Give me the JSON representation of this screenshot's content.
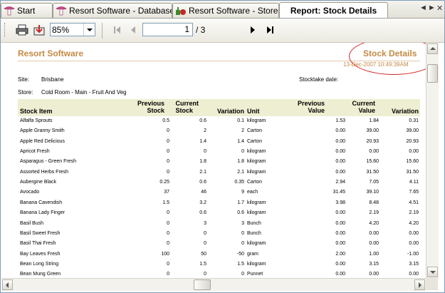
{
  "tabs": [
    {
      "label": "Start",
      "icon": "resort-app-icon"
    },
    {
      "label": "Resort Software - Database",
      "icon": "resort-app-icon"
    },
    {
      "label": "Resort Software - Stores",
      "icon": "stores-icon"
    },
    {
      "label": "Report: Stock Details",
      "icon": ""
    }
  ],
  "tab_controls": {
    "prev": "◄",
    "next": "►",
    "close": "✕"
  },
  "toolbar": {
    "zoom": "85%",
    "page_current": "1",
    "page_total": "/ 3"
  },
  "report": {
    "company": "Resort Software",
    "title": "Stock Details",
    "datetime": "13-Dec-2007   10:49:39AM",
    "site_label": "Site:",
    "site_value": "Brisbane",
    "stocktake_label": "Stocktake date:",
    "store_label": "Store:",
    "store_value": "Cold Room - Main - Fruit And Veg",
    "columns": {
      "item": "Stock Item",
      "prev_stock": "Previous\nStock",
      "cur_stock": "Current\nStock",
      "variation": "Variation",
      "unit": "Unit",
      "prev_value": "Previous\nValue",
      "cur_value": "Current\nValue",
      "var_value": "Variation"
    },
    "rows": [
      [
        "Alfalfa Sprouts",
        "0.5",
        "0.6",
        "0.1",
        "kilogram",
        "1.53",
        "1.84",
        "0.31"
      ],
      [
        "Apple Granny Smith",
        "0",
        "2",
        "2",
        "Carton",
        "0.00",
        "39.00",
        "39.00"
      ],
      [
        "Apple Red Delicious",
        "0",
        "1.4",
        "1.4",
        "Carton",
        "0.00",
        "20.93",
        "20.93"
      ],
      [
        "Apricot Fresh",
        "0",
        "0",
        "0",
        "kilogram",
        "0.00",
        "0.00",
        "0.00"
      ],
      [
        "Asparagus - Green Fresh",
        "0",
        "1.8",
        "1.8",
        "kilogram",
        "0.00",
        "15.60",
        "15.60"
      ],
      [
        "Assorted Herbs Fresh",
        "0",
        "2.1",
        "2.1",
        "kilogram",
        "0.00",
        "31.50",
        "31.50"
      ],
      [
        "Aubergine Black",
        "0.25",
        "0.6",
        "0.35",
        "Carton",
        "2.94",
        "7.05",
        "4.11"
      ],
      [
        "Avocado",
        "37",
        "46",
        "9",
        "each",
        "31.45",
        "39.10",
        "7.65"
      ],
      [
        "Banana Cavendish",
        "1.5",
        "3.2",
        "1.7",
        "kilogram",
        "3.98",
        "8.48",
        "4.51"
      ],
      [
        "Banana Lady Finger",
        "0",
        "0.6",
        "0.6",
        "kilogram",
        "0.00",
        "2.19",
        "2.19"
      ],
      [
        "Basil Bush",
        "0",
        "3",
        "3",
        "Bunch",
        "0.00",
        "4.20",
        "4.20"
      ],
      [
        "Basil Sweet Fresh",
        "0",
        "0",
        "0",
        "Bunch",
        "0.00",
        "0.00",
        "0.00"
      ],
      [
        "Basil Thai Fresh",
        "0",
        "0",
        "0",
        "kilogram",
        "0.00",
        "0.00",
        "0.00"
      ],
      [
        "Bay Leaves Fresh",
        "100",
        "50",
        "-50",
        "gram",
        "2.00",
        "1.00",
        "-1.00"
      ],
      [
        "Bean Long String",
        "0",
        "1.5",
        "1.5",
        "kilogram",
        "0.00",
        "3.15",
        "3.15"
      ],
      [
        "Bean Mung Green",
        "0",
        "0",
        "0",
        "Punnet",
        "0.00",
        "0.00",
        "0.00"
      ]
    ]
  },
  "colors": {
    "accent": "#c48a45",
    "header_bg": "#eeeed2",
    "highlight_oval": "#d62b2b"
  }
}
